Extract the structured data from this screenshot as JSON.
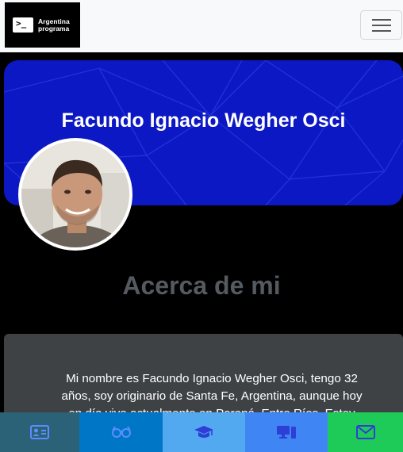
{
  "navbar": {
    "brand_line1": "Argentina",
    "brand_line2": "programa",
    "brand_prompt": ">_",
    "menu_icon": "hamburger-menu-icon"
  },
  "banner": {
    "name": "Facundo Ignacio Wegher Osci",
    "background": "#0c18c4"
  },
  "about": {
    "title": "Acerca de mi",
    "text": "Mi nombre es Facundo Ignacio Wegher Osci, tengo 32 años, soy originario de Santa Fe, Argentina, aunque hoy en día vivo actualmente en Paraná, Entre Ríos. Estoy cursando desde"
  },
  "bottom_nav": [
    {
      "icon": "id-card-icon",
      "color": "#2c6278"
    },
    {
      "icon": "glasses-icon",
      "color": "#0077c6"
    },
    {
      "icon": "graduation-cap-icon",
      "color": "#53a9f0"
    },
    {
      "icon": "desktop-icon",
      "color": "#3f86f4"
    },
    {
      "icon": "envelope-icon",
      "color": "#1fcb58"
    }
  ]
}
